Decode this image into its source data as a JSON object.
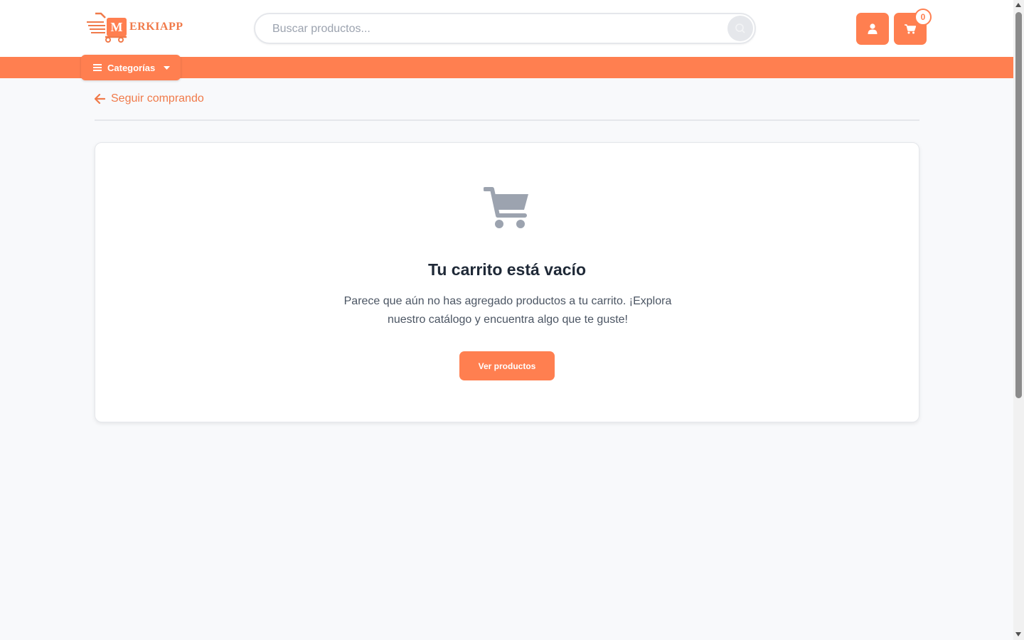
{
  "header": {
    "logo_letter": "M",
    "logo_text": "ERKIAPP",
    "search_placeholder": "Buscar productos...",
    "cart_count": "0"
  },
  "nav": {
    "categories_label": "Categorías"
  },
  "back_link": {
    "label": "Seguir comprando"
  },
  "empty_cart": {
    "title": "Tu carrito está vacío",
    "message": "Parece que aún no has agregado productos a tu carrito. ¡Explora nuestro catálogo y encuentra algo que te guste!",
    "button_label": "Ver productos"
  },
  "colors": {
    "accent": "#ff7f50",
    "muted_icon": "#9ca3af"
  },
  "icons": [
    "logo-cart-icon",
    "search-icon",
    "user-icon",
    "cart-icon",
    "menu-icon",
    "caret-down-icon",
    "arrow-left-icon",
    "empty-cart-icon"
  ]
}
